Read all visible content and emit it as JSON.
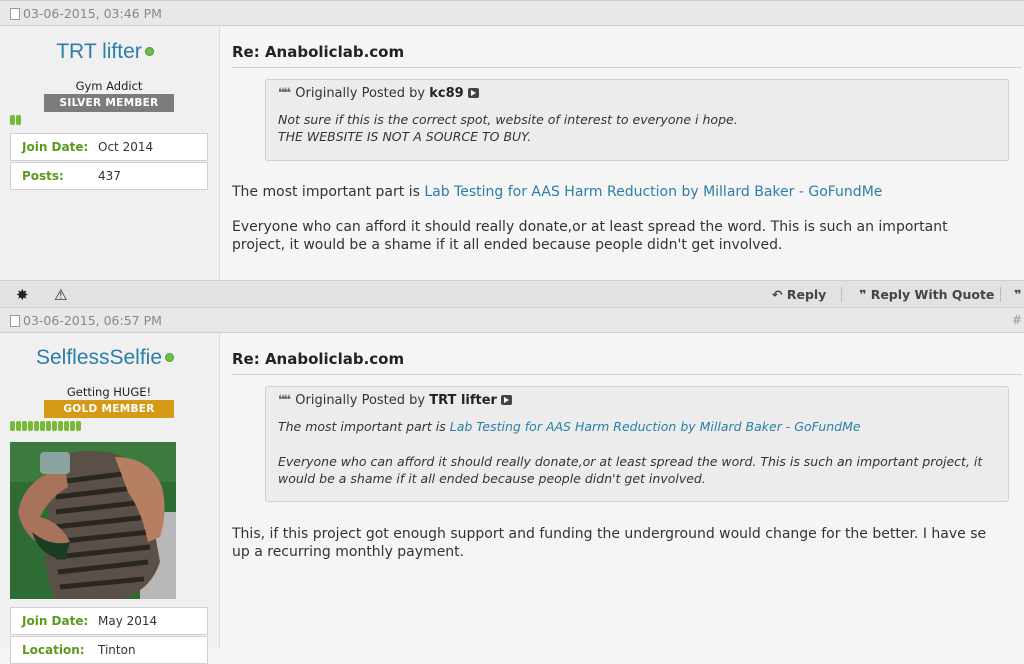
{
  "posts": [
    {
      "date": "03-06-2015, 03:46 PM",
      "username": "TRT lifter",
      "user_title": "Gym Addict",
      "rank": "SILVER MEMBER",
      "join_label": "Join Date:",
      "join_value": "Oct 2014",
      "posts_label": "Posts:",
      "posts_value": "437",
      "title": "Re: Anaboliclab.com",
      "quote_prefix": "Originally Posted by",
      "quote_author": "kc89",
      "quote_line1": "Not sure if this is the correct spot, website of interest to everyone i hope.",
      "quote_line2": "THE WEBSITE IS NOT A SOURCE TO BUY.",
      "body_prefix": "The most important part is",
      "body_link": "Lab Testing for AAS Harm Reduction by Millard Baker - GoFundMe",
      "body_line1": "Everyone who can afford it should really donate,or at least spread the word. This is such an important",
      "body_line2": "project, it would be a shame if it all ended because people didn't get involved."
    },
    {
      "date": "03-06-2015, 06:57 PM",
      "post_number": "#",
      "username": "SelflessSelfie",
      "user_title": "Getting HUGE!",
      "rank": "GOLD MEMBER",
      "join_label": "Join Date:",
      "join_value": "May 2014",
      "location_label": "Location:",
      "location_value": "Tinton",
      "title": "Re: Anaboliclab.com",
      "quote_prefix": "Originally Posted by",
      "quote_author": "TRT lifter",
      "quote_line1_prefix": "The most important part is",
      "quote_link": "Lab Testing for AAS Harm Reduction by Millard Baker - GoFundMe",
      "quote_line2": "Everyone who can afford it should really donate,or at least spread the word. This is such an important project, it",
      "quote_line3": "would be a shame if it all ended because people didn't get involved.",
      "body_line1": "This, if this project got enough support and funding the underground would change for the better. I have se",
      "body_line2": "up a recurring monthly payment."
    }
  ],
  "actions": {
    "reply": "Reply",
    "reply_quote": "Reply With Quote"
  },
  "colors": {
    "username": "#2a7fa8",
    "info_label": "#5a9a1e",
    "rank_silver": "#7c7c7c",
    "rank_gold": "#d49a18"
  },
  "reputation": {
    "post1_pips": 2,
    "post2_pips": 12
  }
}
